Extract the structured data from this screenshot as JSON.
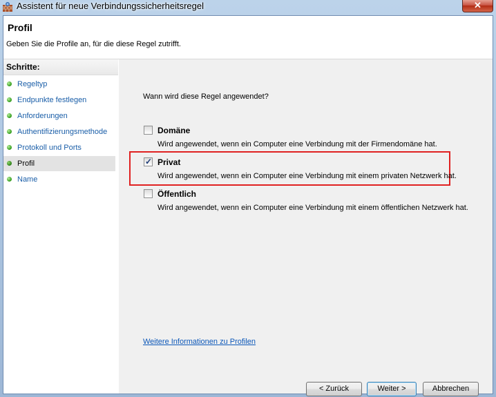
{
  "window": {
    "title": "Assistent für neue Verbindungssicherheitsregel",
    "close_label": "✕"
  },
  "header": {
    "title": "Profil",
    "subtitle": "Geben Sie die Profile an, für die diese Regel zutrifft."
  },
  "steps": {
    "heading": "Schritte:",
    "items": [
      {
        "label": "Regeltyp"
      },
      {
        "label": "Endpunkte festlegen"
      },
      {
        "label": "Anforderungen"
      },
      {
        "label": "Authentifizierungsmethode"
      },
      {
        "label": "Protokoll und Ports"
      },
      {
        "label": "Profil"
      },
      {
        "label": "Name"
      }
    ],
    "current": "Profil"
  },
  "main": {
    "question": "Wann wird diese Regel angewendet?",
    "options": [
      {
        "label": "Domäne",
        "description": "Wird angewendet, wenn ein Computer eine Verbindung mit der Firmendomäne hat.",
        "checked": false
      },
      {
        "label": "Privat",
        "description": "Wird angewendet, wenn ein Computer eine Verbindung mit einem privaten Netzwerk hat.",
        "checked": true
      },
      {
        "label": "Öffentlich",
        "description": "Wird angewendet, wenn ein Computer eine Verbindung mit einem öffentlichen Netzwerk hat.",
        "checked": false
      }
    ],
    "info_link": "Weitere Informationen zu Profilen"
  },
  "buttons": {
    "back": "< Zurück",
    "next": "Weiter >",
    "cancel": "Abbrechen"
  },
  "colors": {
    "highlight": "#e02020",
    "link": "#0a56b8",
    "step_dot": "#2f9a1a"
  }
}
